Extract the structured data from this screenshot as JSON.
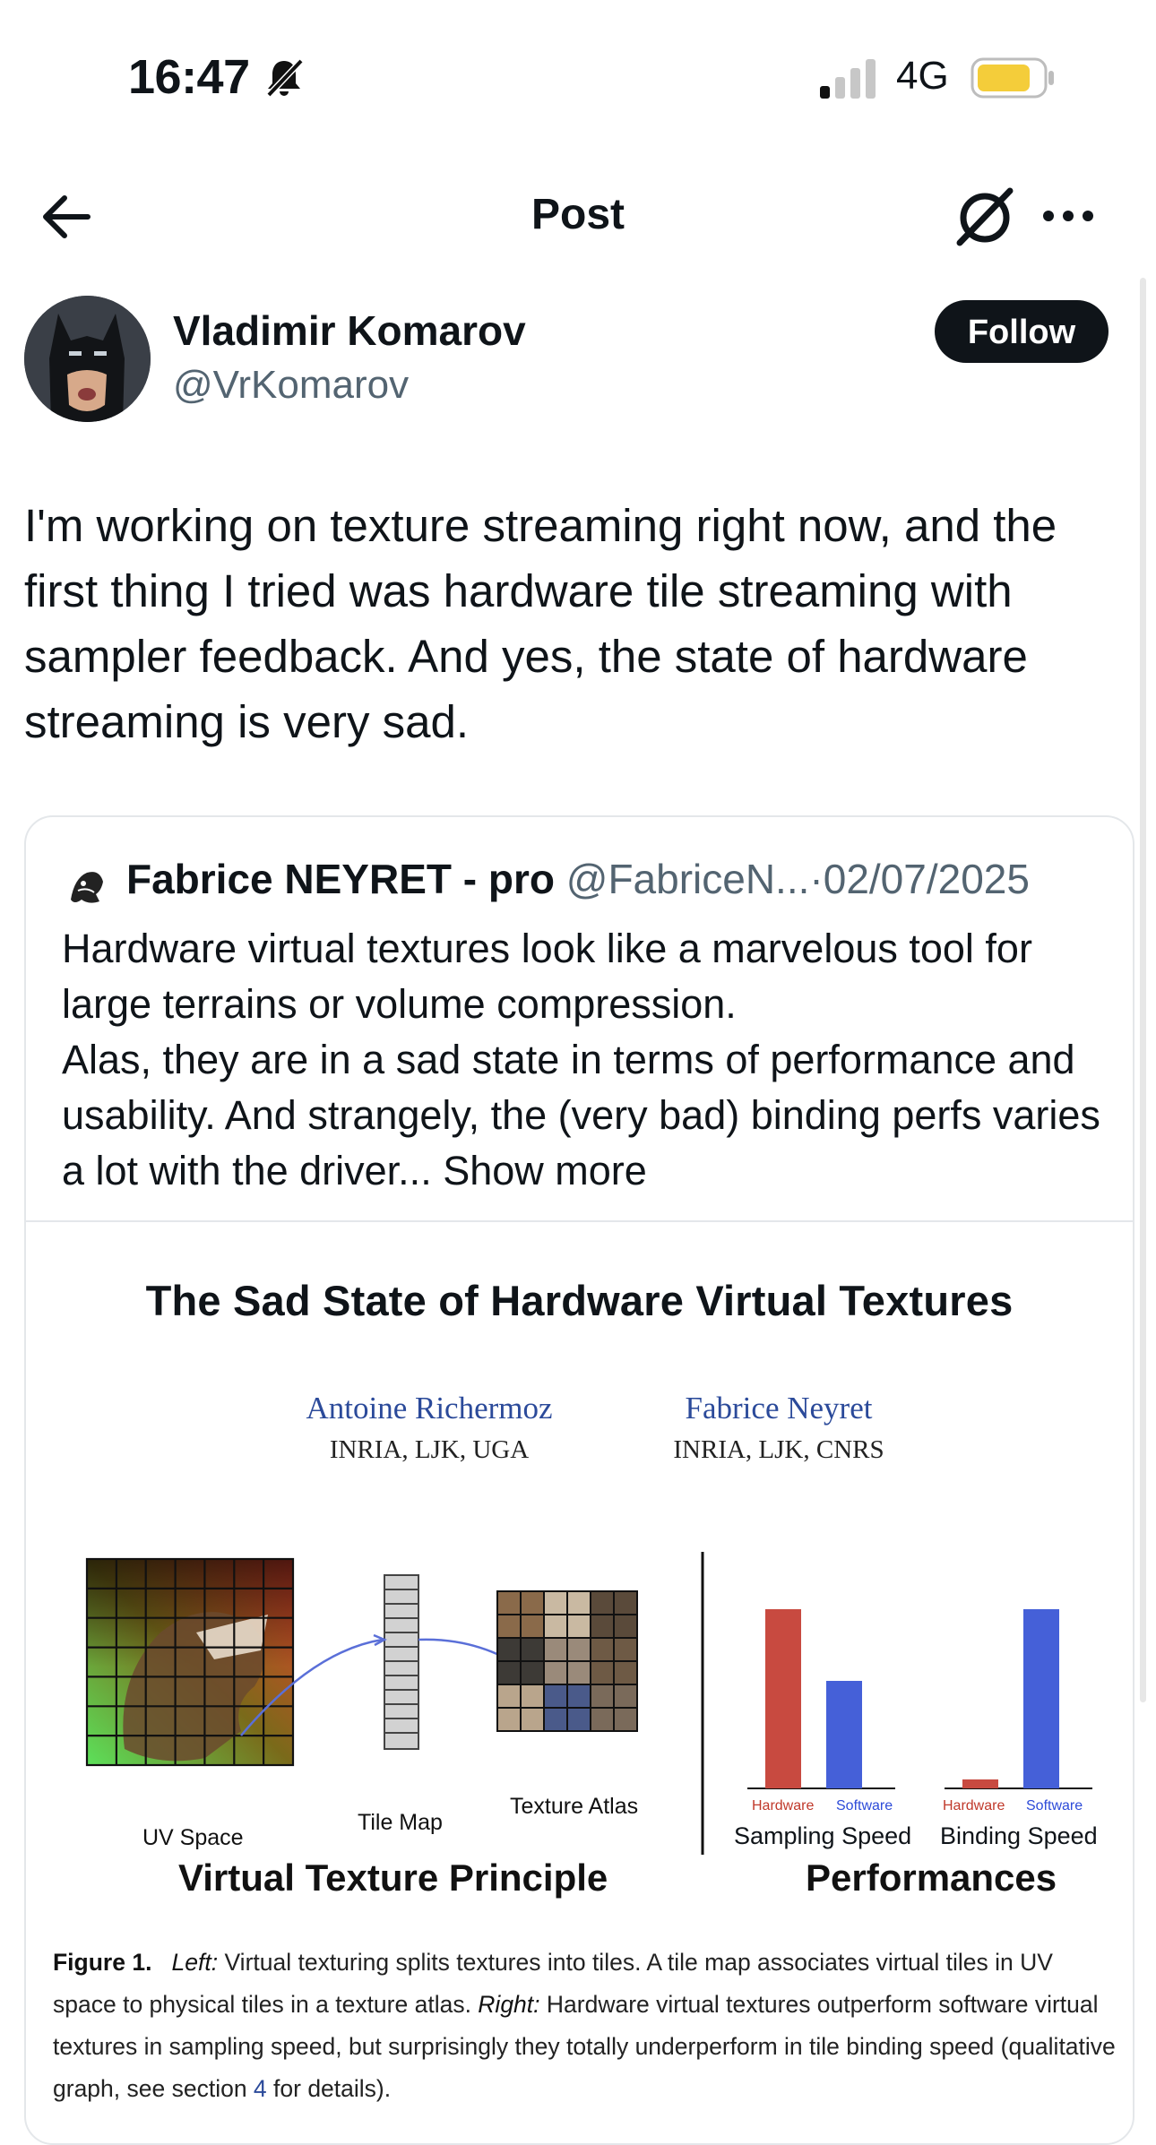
{
  "status_bar": {
    "time": "16:47",
    "network": "4G",
    "battery_color": "#f4cd3a",
    "icons": [
      "bell-slash-icon",
      "signal-icon",
      "battery-icon"
    ]
  },
  "nav": {
    "title": "Post",
    "icons": [
      "back-arrow-icon",
      "grok-icon",
      "more-icon"
    ]
  },
  "post": {
    "author_name": "Vladimir Komarov",
    "author_handle": "@VrKomarov",
    "follow_label": "Follow",
    "text": "I'm working on texture streaming right now, and the first thing I tried was hardware tile streaming with sampler feedback. And yes, the state of hardware streaming is very sad."
  },
  "quote": {
    "author_name": "Fabrice NEYRET - pro",
    "author_handle": "@FabriceN...",
    "separator": "·",
    "date": "02/07/2025",
    "text": "Hardware virtual textures look like a marvelous tool for large terrains or volume compression.\nAlas, they are in a sad state in terms of performance and usability. And strangely, the (very bad) binding perfs varies a lot with the driver...",
    "show_more": "Show more"
  },
  "figure": {
    "paper_title": "The Sad State of Hardware Virtual Textures",
    "authors": [
      {
        "name": "Antoine Richermoz",
        "affiliation": "INRIA, LJK, UGA"
      },
      {
        "name": "Fabrice Neyret",
        "affiliation": "INRIA, LJK, CNRS"
      }
    ],
    "left_panel": {
      "title": "Virtual Texture Principle",
      "labels": {
        "uv": "UV Space",
        "tile_map": "Tile Map",
        "atlas": "Texture Atlas"
      }
    },
    "right_panel": {
      "title": "Performances",
      "colors": {
        "hardware": "#c84a40",
        "software": "#4560d8"
      }
    },
    "caption": {
      "fig_label": "Figure 1.",
      "left_label": "Left:",
      "left_text": " Virtual texturing splits textures into tiles. A tile map associates virtual tiles in UV space to physical tiles in a texture atlas. ",
      "right_label": "Right:",
      "right_text": " Hardware virtual textures outperform software virtual textures in sampling speed, but surprisingly they totally underperform in tile binding speed (qualitative graph, see section ",
      "section_ref": "4",
      "tail": " for details)."
    }
  },
  "chart_data": [
    {
      "type": "bar",
      "xlabel": "Sampling Speed",
      "categories": [
        "Hardware",
        "Software"
      ],
      "values": [
        1.0,
        0.6
      ],
      "colors": [
        "#c84a40",
        "#4560d8"
      ]
    },
    {
      "type": "bar",
      "xlabel": "Binding Speed",
      "categories": [
        "Hardware",
        "Software"
      ],
      "values": [
        0.05,
        1.0
      ],
      "colors": [
        "#c84a40",
        "#4560d8"
      ]
    }
  ]
}
